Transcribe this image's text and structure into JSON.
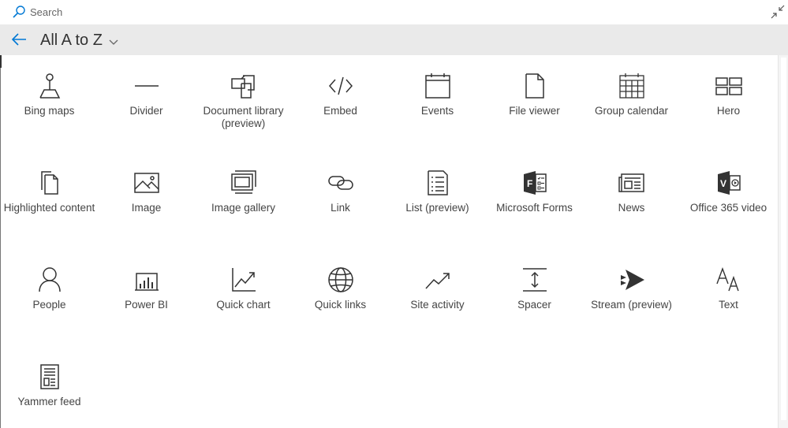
{
  "search": {
    "placeholder": "Search"
  },
  "header": {
    "filter_label": "All A to Z"
  },
  "webparts": [
    {
      "label": "Bing maps",
      "icon": "bing-maps-icon"
    },
    {
      "label": "Divider",
      "icon": "divider-icon"
    },
    {
      "label": "Document library (preview)",
      "icon": "document-library-icon"
    },
    {
      "label": "Embed",
      "icon": "embed-icon"
    },
    {
      "label": "Events",
      "icon": "events-icon"
    },
    {
      "label": "File viewer",
      "icon": "file-viewer-icon"
    },
    {
      "label": "Group calendar",
      "icon": "group-calendar-icon"
    },
    {
      "label": "Hero",
      "icon": "hero-icon"
    },
    {
      "label": "Highlighted content",
      "icon": "highlighted-content-icon"
    },
    {
      "label": "Image",
      "icon": "image-icon"
    },
    {
      "label": "Image gallery",
      "icon": "image-gallery-icon"
    },
    {
      "label": "Link",
      "icon": "link-icon"
    },
    {
      "label": "List (preview)",
      "icon": "list-icon"
    },
    {
      "label": "Microsoft Forms",
      "icon": "microsoft-forms-icon"
    },
    {
      "label": "News",
      "icon": "news-icon"
    },
    {
      "label": "Office 365 video",
      "icon": "office-365-video-icon"
    },
    {
      "label": "People",
      "icon": "people-icon"
    },
    {
      "label": "Power BI",
      "icon": "power-bi-icon"
    },
    {
      "label": "Quick chart",
      "icon": "quick-chart-icon"
    },
    {
      "label": "Quick links",
      "icon": "quick-links-icon"
    },
    {
      "label": "Site activity",
      "icon": "site-activity-icon"
    },
    {
      "label": "Spacer",
      "icon": "spacer-icon"
    },
    {
      "label": "Stream (preview)",
      "icon": "stream-icon"
    },
    {
      "label": "Text",
      "icon": "text-icon"
    },
    {
      "label": "Yammer feed",
      "icon": "yammer-feed-icon"
    }
  ],
  "colors": {
    "accent": "#0078d4",
    "header_background": "#eaeaea",
    "icon_stroke": "#333333"
  }
}
